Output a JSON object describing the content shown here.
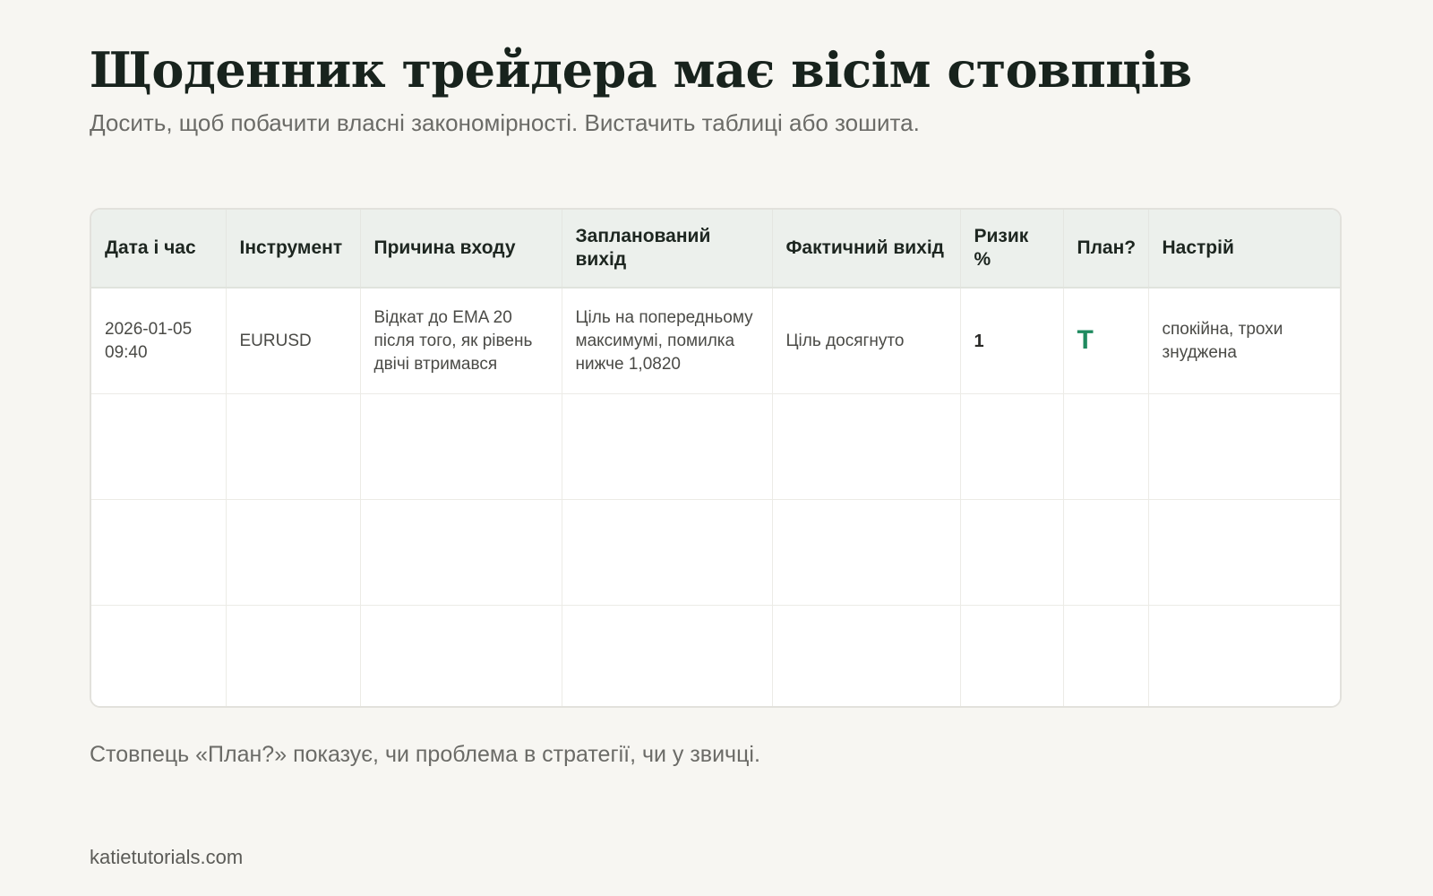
{
  "header": {
    "title": "Щоденник трейдера має вісім стовпців",
    "subtitle": "Досить, щоб побачити власні закономірності. Вистачить таблиці або зошита."
  },
  "table": {
    "columns": [
      "Дата і час",
      "Інструмент",
      "Причина входу",
      "Запланований вихід",
      "Фактичний вихід",
      "Ризик %",
      "План?",
      "Настрій"
    ],
    "rows": [
      {
        "datetime": "2026-01-05 09:40",
        "instrument": "EURUSD",
        "entry_reason": "Відкат до EMA 20 після того, як рівень двічі втримався",
        "planned_exit": "Ціль на попередньому максимумі, помилка нижче 1,0820",
        "actual_exit": "Ціль досягнуто",
        "risk": "1",
        "plan": "Т",
        "mood": "спокійна, трохи знуджена"
      },
      {
        "datetime": "",
        "instrument": "",
        "entry_reason": "",
        "planned_exit": "",
        "actual_exit": "",
        "risk": "",
        "plan": "",
        "mood": ""
      },
      {
        "datetime": "",
        "instrument": "",
        "entry_reason": "",
        "planned_exit": "",
        "actual_exit": "",
        "risk": "",
        "plan": "",
        "mood": ""
      },
      {
        "datetime": "",
        "instrument": "",
        "entry_reason": "",
        "planned_exit": "",
        "actual_exit": "",
        "risk": "",
        "plan": "",
        "mood": ""
      }
    ]
  },
  "note": "Стовпець «План?» показує, чи проблема в стратегії, чи у звичці.",
  "footer": {
    "site": "katietutorials.com"
  },
  "colors": {
    "background": "#f7f6f2",
    "title": "#18231d",
    "header_row_bg": "#ecf0ec",
    "plan_mark": "#1f8a5f"
  }
}
